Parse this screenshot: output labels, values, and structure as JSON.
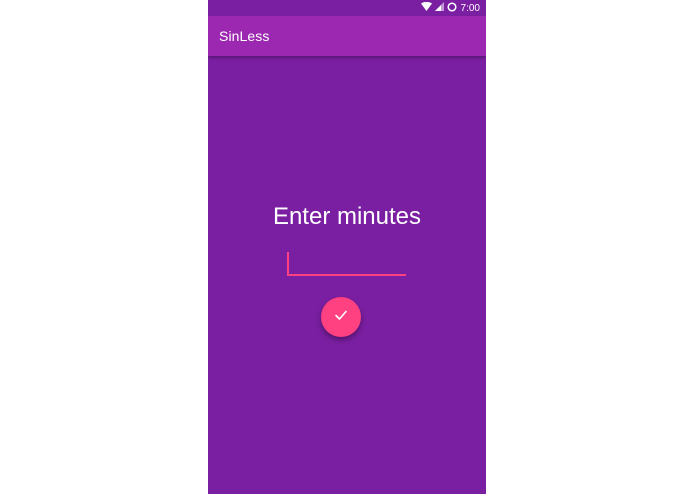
{
  "status_bar": {
    "time": "7:00",
    "icons": [
      "wifi-icon",
      "signal-icon",
      "battery-icon"
    ]
  },
  "app_bar": {
    "title": "SinLess"
  },
  "main": {
    "prompt": "Enter minutes",
    "minutes_input": {
      "value": "",
      "placeholder": ""
    },
    "submit_button": {
      "icon": "check-icon"
    }
  },
  "colors": {
    "background": "#7b1fa2",
    "app_bar": "#9c27b0",
    "accent": "#ff4081",
    "text": "#ffffff"
  }
}
